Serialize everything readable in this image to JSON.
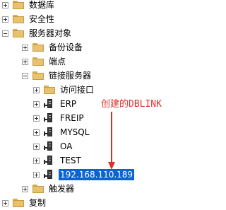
{
  "tree": {
    "nodes": [
      {
        "label": "数据库",
        "icon": "folder-icon"
      },
      {
        "label": "安全性",
        "icon": "folder-icon"
      },
      {
        "label": "服务器对象",
        "icon": "folder-icon"
      },
      {
        "label": "备份设备",
        "icon": "folder-icon"
      },
      {
        "label": "端点",
        "icon": "folder-icon"
      },
      {
        "label": "链接服务器",
        "icon": "folder-icon"
      },
      {
        "label": "访问接口",
        "icon": "folder-icon"
      },
      {
        "label": "ERP",
        "icon": "linked-server-icon"
      },
      {
        "label": "FREIP",
        "icon": "linked-server-icon"
      },
      {
        "label": "MYSQL",
        "icon": "linked-server-icon"
      },
      {
        "label": "OA",
        "icon": "linked-server-icon"
      },
      {
        "label": "TEST",
        "icon": "linked-server-icon"
      },
      {
        "label": "192.168.110.189",
        "icon": "linked-server-icon",
        "selected": true
      },
      {
        "label": "触发器",
        "icon": "folder-icon"
      },
      {
        "label": "复制",
        "icon": "folder-icon"
      }
    ]
  },
  "annotation": {
    "text": "创建的DBLINK",
    "color": "#e0302a"
  },
  "colors": {
    "selection": "#0a64d4",
    "folder": "#e8c26e"
  }
}
